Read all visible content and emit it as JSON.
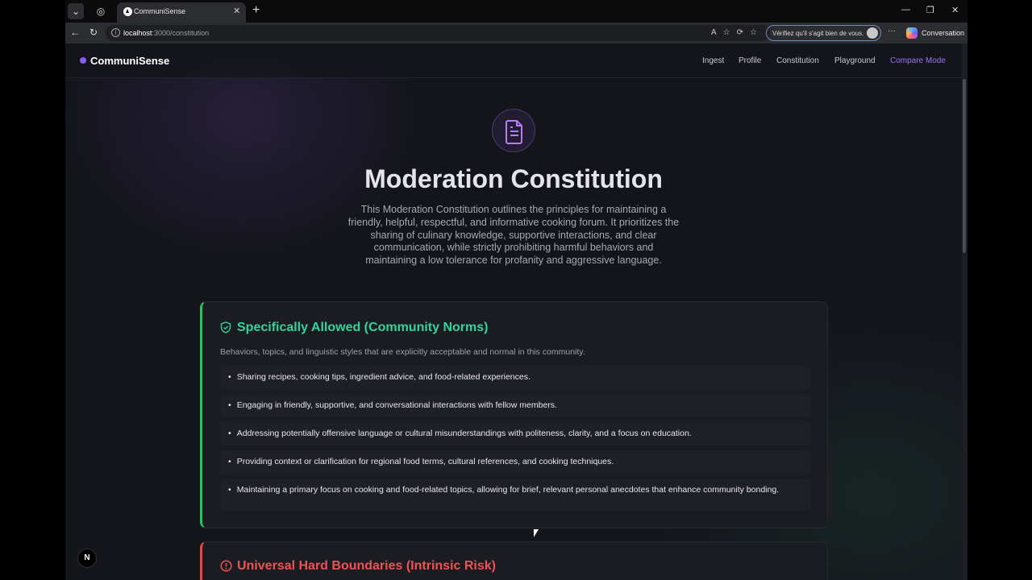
{
  "browser": {
    "tab_title": "CommuniSense",
    "url_host": "localhost",
    "url_path": ":3000/constitution",
    "verify_text": "Vérifiez qu'il s'agit bien de vous.",
    "conversation_label": "Conversation"
  },
  "nav": {
    "brand": "CommuniSense",
    "links": [
      "Ingest",
      "Profile",
      "Constitution",
      "Playground",
      "Compare Mode"
    ],
    "active": "Compare Mode"
  },
  "hero": {
    "icon": "document-icon",
    "title": "Moderation Constitution",
    "description": "This Moderation Constitution outlines the principles for maintaining a friendly, helpful, respectful, and informative cooking forum. It prioritizes the sharing of culinary knowledge, supportive interactions, and clear communication, while strictly prohibiting harmful behaviors and maintaining a low tolerance for profanity and aggressive language."
  },
  "allowed": {
    "icon": "shield-check-icon",
    "title": "Specifically Allowed (Community Norms)",
    "description": "Behaviors, topics, and linguistic styles that are explicitly acceptable and normal in this community.",
    "items": [
      "Sharing recipes, cooking tips, ingredient advice, and food-related experiences.",
      "Engaging in friendly, supportive, and conversational interactions with fellow members.",
      "Addressing potentially offensive language or cultural misunderstandings with politeness, clarity, and a focus on education.",
      "Providing context or clarification for regional food terms, cultural references, and cooking techniques.",
      "Maintaining a primary focus on cooking and food-related topics, allowing for brief, relevant personal anecdotes that enhance community bonding."
    ]
  },
  "boundaries": {
    "icon": "alert-circle-icon",
    "title": "Universal Hard Boundaries (Intrinsic Risk)"
  },
  "colors": {
    "accent": "#8b5cf6",
    "allowed": "#34d399",
    "danger": "#f05252"
  },
  "floating_button": "N"
}
